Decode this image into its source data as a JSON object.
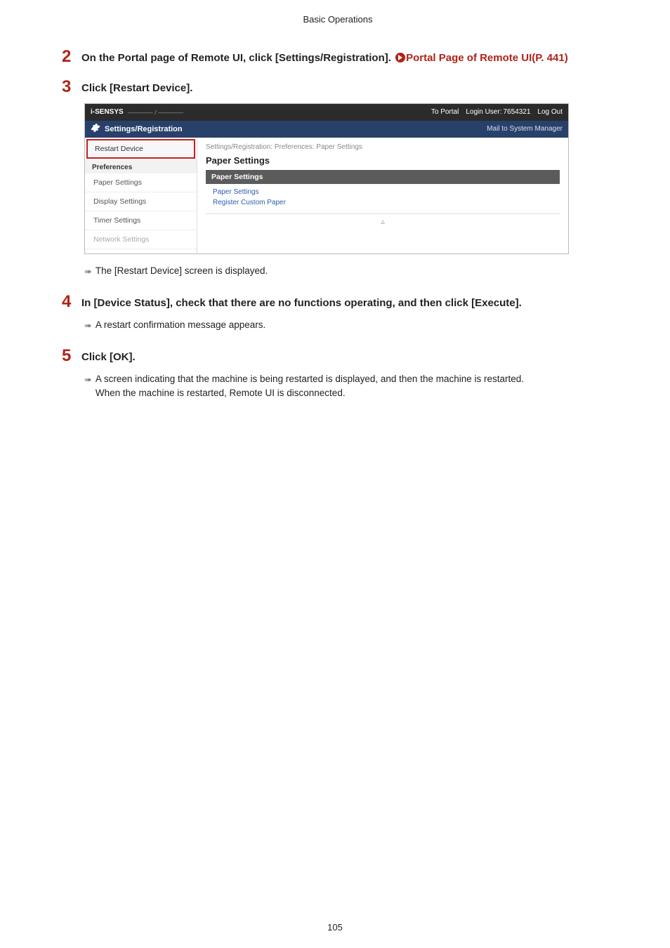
{
  "header": {
    "title": "Basic Operations"
  },
  "steps": {
    "s2": {
      "num": "2",
      "text_a": "On the Portal page of Remote UI, click [Settings/Registration]. ",
      "link": "Portal Page of Remote UI(P. 441)"
    },
    "s3": {
      "num": "3",
      "text": "Click [Restart Device].",
      "sub": "The [Restart Device] screen is displayed."
    },
    "s4": {
      "num": "4",
      "text": "In [Device Status], check that there are no functions operating, and then click [Execute].",
      "sub": "A restart confirmation message appears."
    },
    "s5": {
      "num": "5",
      "text": "Click [OK].",
      "sub1": "A screen indicating that the machine is being restarted is displayed, and then the machine is restarted.",
      "sub2": "When the machine is restarted, Remote UI is disconnected."
    }
  },
  "ui": {
    "brand": "i-SENSYS",
    "model": "———— / ————",
    "to_portal": "To Portal",
    "login_user_label": "Login User:",
    "login_user": "7654321",
    "logout": "Log Out",
    "bar_title": "Settings/Registration",
    "mail": "Mail to System Manager",
    "side": {
      "restart": "Restart Device",
      "prefs": "Preferences",
      "paper": "Paper Settings",
      "display": "Display Settings",
      "timer": "Timer Settings",
      "network": "Network Settings"
    },
    "main": {
      "crumb": "Settings/Registration: Preferences: Paper Settings",
      "h1": "Paper Settings",
      "bar": "Paper Settings",
      "link1": "Paper Settings",
      "link2": "Register Custom Paper",
      "end": "▵"
    }
  },
  "page_number": "105"
}
